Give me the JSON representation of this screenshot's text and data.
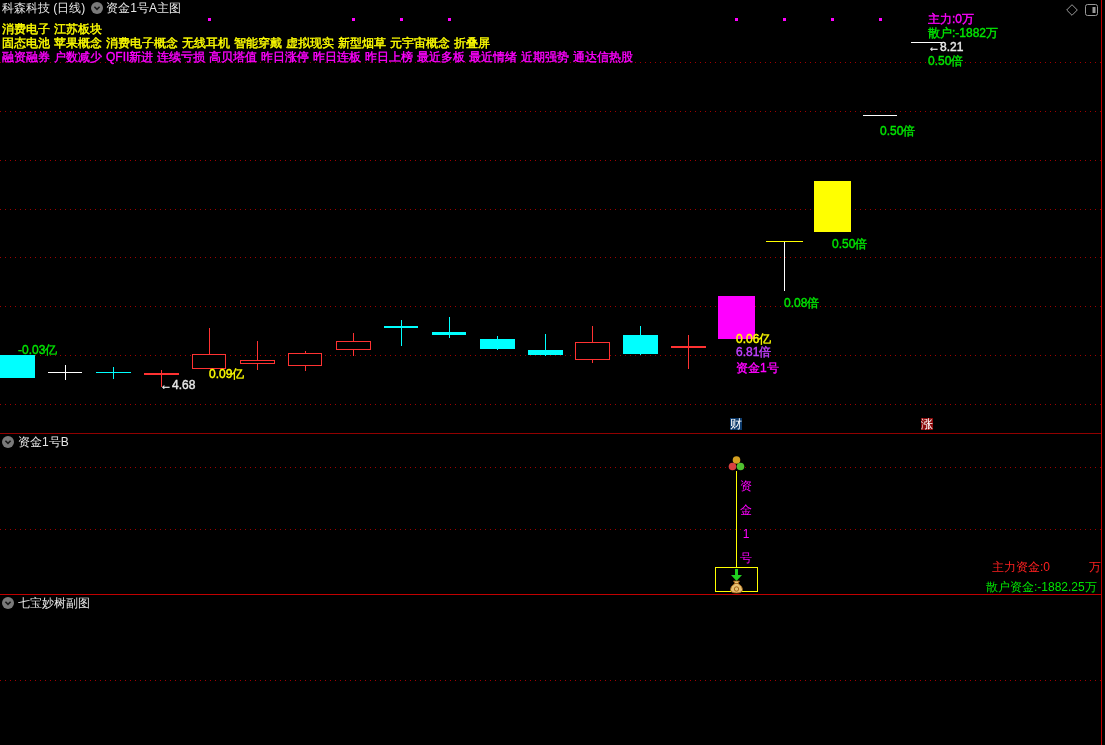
{
  "main_chart": {
    "stock": "科森科技 (日线)",
    "indicator": "资金1号A主图",
    "tag_rows": [
      {
        "color": "#ffff00",
        "tags": [
          "消费电子",
          "江苏板块"
        ]
      },
      {
        "color": "#ffff00",
        "tags": [
          "固态电池",
          "苹果概念",
          "消费电子概念",
          "无线耳机",
          "智能穿戴",
          "虚拟现实",
          "新型烟草",
          "元宇宙概念",
          "折叠屏"
        ]
      },
      {
        "color": "#ff00ff",
        "tags": [
          "融资融券",
          "户数减少",
          "QFII新进",
          "连续亏损",
          "高贝塔值",
          "昨日涨停",
          "昨日连板",
          "昨日上榜",
          "最近多板",
          "最近情绪",
          "近期强势",
          "通达信热股"
        ]
      }
    ],
    "annotations": [
      {
        "text": "-0.03亿",
        "color": "#00e600"
      },
      {
        "text": "←4.68",
        "color": "#e8e8e8"
      },
      {
        "text": "0.09亿",
        "color": "#ffff00"
      },
      {
        "text": "0.06亿",
        "color": "#ffff00"
      },
      {
        "text": "6.81倍",
        "color": "#c040ff"
      },
      {
        "text": "资金1号",
        "color": "#ff00ff"
      },
      {
        "text": "0.08倍",
        "color": "#00e600"
      },
      {
        "text": "0.50倍",
        "color": "#00e600"
      },
      {
        "text": "0.50倍",
        "color": "#00e600"
      },
      {
        "text": "主力:0万",
        "color": "#ff00ff"
      },
      {
        "text": "散户:-1882万",
        "color": "#00e600"
      },
      {
        "text": "←8.21",
        "color": "#e8e8e8"
      },
      {
        "text": "0.50倍",
        "color": "#00e600"
      }
    ],
    "event_badges": [
      {
        "text": "财",
        "color": "#0c3a6b"
      },
      {
        "text": "涨",
        "color": "#8c0a0a"
      }
    ]
  },
  "fund_panel": {
    "title": "资金1号B",
    "signal_label": "资金1号",
    "main_fund_label": "主力资金:0",
    "main_fund_unit": "万",
    "retail_fund": "散户资金:-1882.25万"
  },
  "sub_panel": {
    "title": "七宝妙树副图"
  }
}
